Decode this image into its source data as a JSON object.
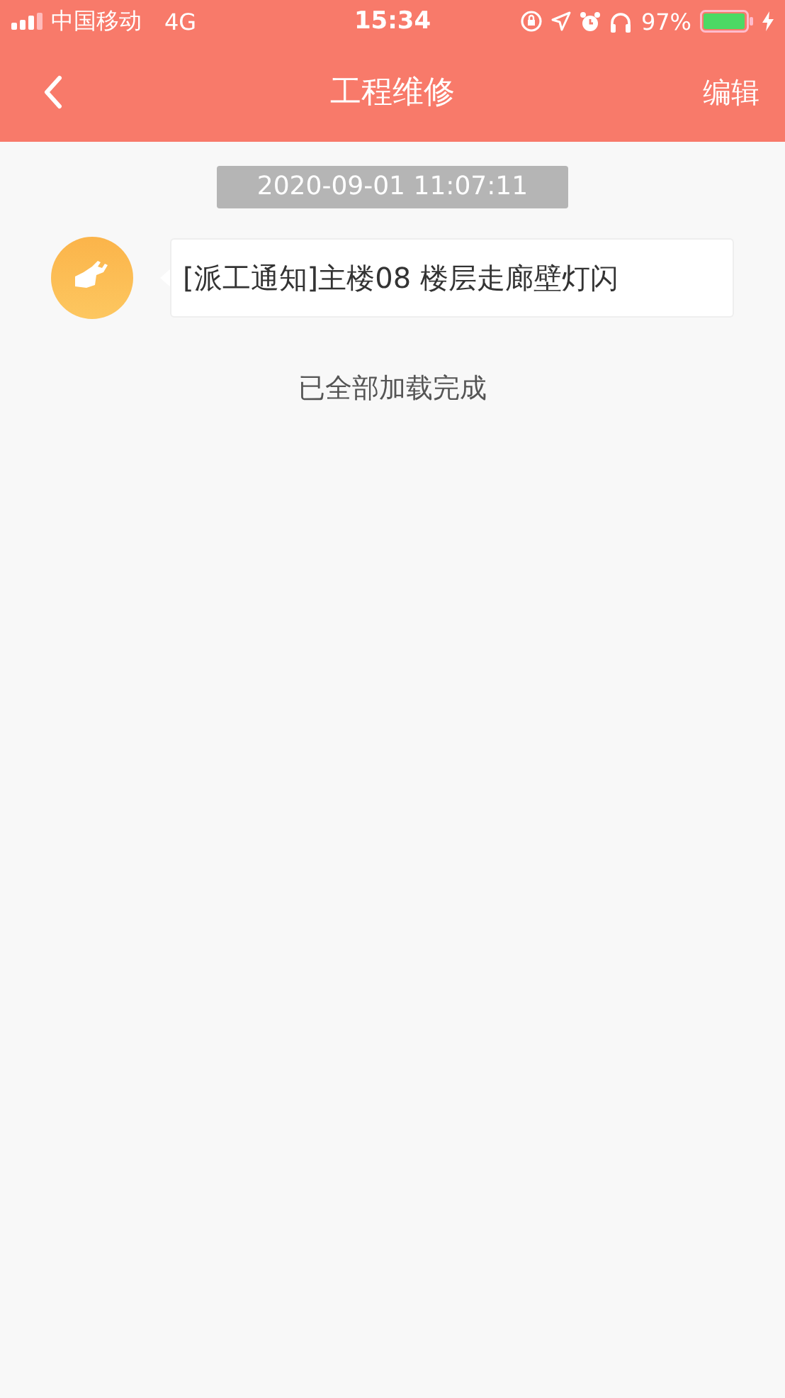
{
  "status_bar": {
    "carrier": "中国移动",
    "network": "4G",
    "time": "15:34",
    "battery": "97%"
  },
  "nav": {
    "title": "工程维修",
    "action": "编辑"
  },
  "messages": [
    {
      "time": "2020-09-01 11:07:11",
      "text": "[派工通知]主楼08 楼层走廊壁灯闪"
    }
  ],
  "footer": "已全部加载完成"
}
